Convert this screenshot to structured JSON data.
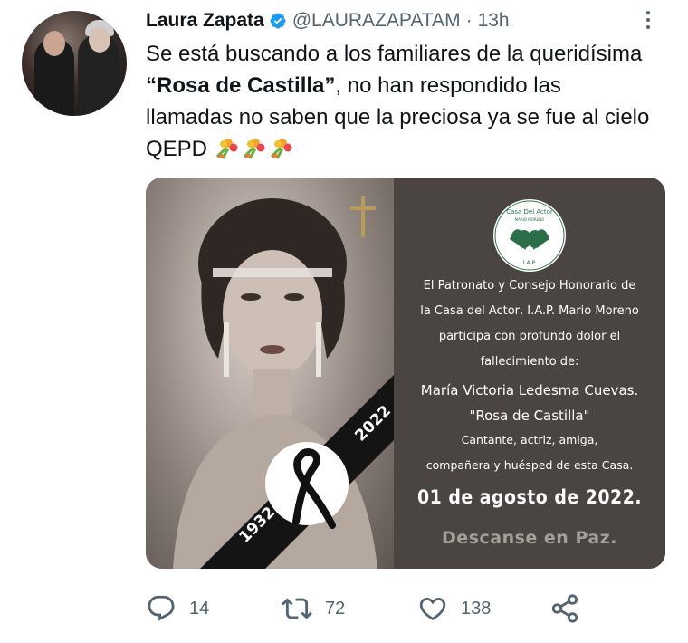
{
  "tweet": {
    "author_name": "Laura Zapata",
    "handle": "@LAURAZAPATAM",
    "separator": "·",
    "time": "13h",
    "text_part1": "Se está buscando a los familiares de la queridísima ",
    "text_bold": "“Rosa de Castilla”",
    "text_part2": ", no han respondido las llamadas no saben que la preciosa ya se fue al cielo QEPD "
  },
  "media": {
    "ribbon_year_start": "1932",
    "ribbon_year_end": "2022",
    "logo_text_top": "Casa Del Actor",
    "logo_text_sub": "MARIO MORENO",
    "logo_text_bottom": "I.A.P.",
    "line1": "El Patronato y Consejo Honorario de",
    "line2": "la Casa del Actor, I.A.P. Mario Moreno",
    "line3": "participa con profundo dolor el",
    "line4": "fallecimiento de:",
    "line5": "María Victoria Ledesma Cuevas.",
    "line6": "\"Rosa de Castilla\"",
    "line7": "Cantante, actriz, amiga,",
    "line8": "compañera y huésped de esta Casa.",
    "line9": "01 de agosto de 2022.",
    "line10": "Descanse en Paz."
  },
  "actions": {
    "replies": "14",
    "retweets": "72",
    "likes": "138"
  },
  "icons": {
    "verified": "verified-badge-icon",
    "reply": "reply-icon",
    "retweet": "retweet-icon",
    "like": "heart-icon",
    "share": "share-icon",
    "more": "more-icon",
    "emoji": "bouquet-emoji"
  },
  "colors": {
    "accent": "#1d9bf0",
    "secondary_text": "#536471",
    "panel_bg": "#4a4442"
  }
}
